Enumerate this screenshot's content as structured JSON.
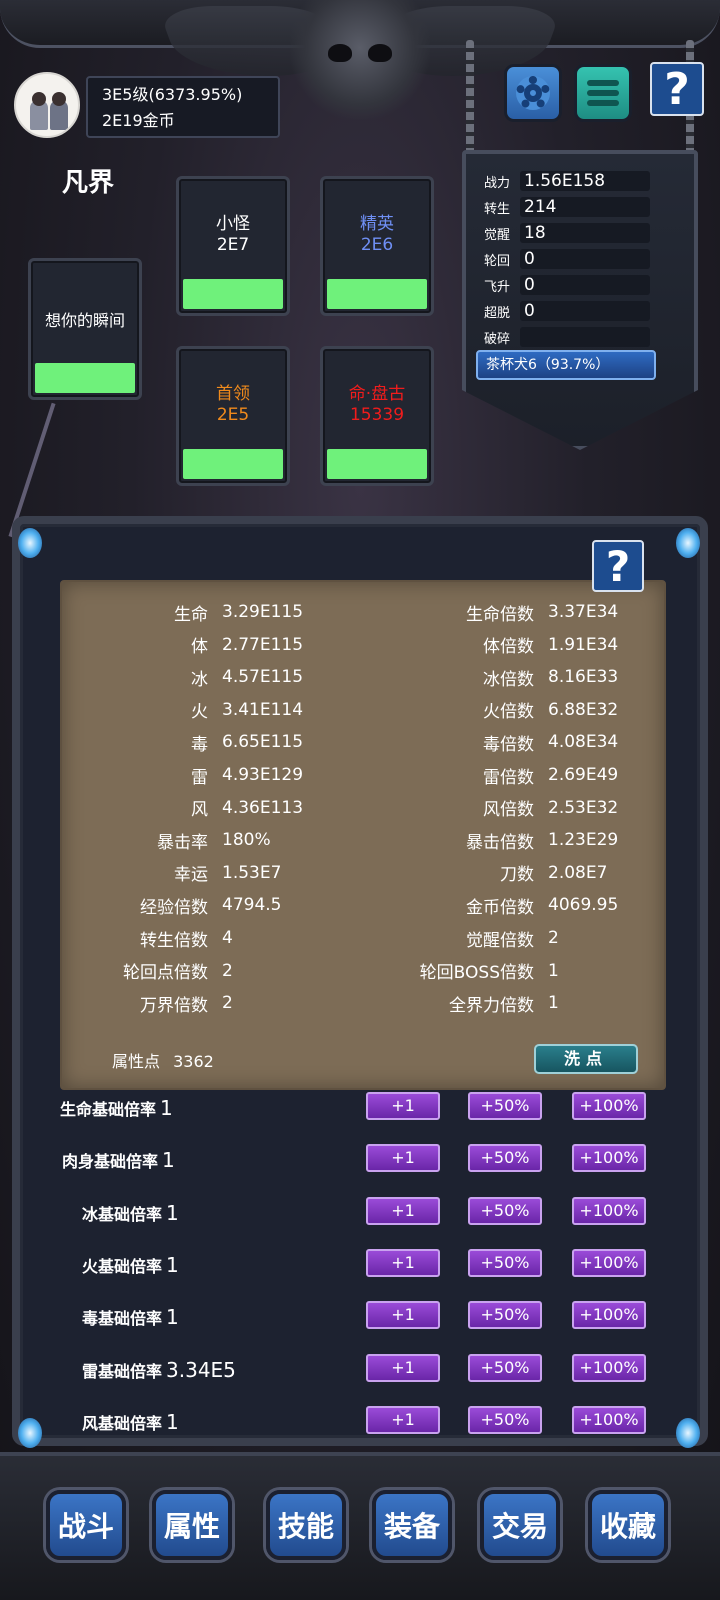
{
  "player": {
    "level_text": "3E5级(6373.95%)",
    "gold_text": "2E19金币"
  },
  "world": {
    "name": "凡界"
  },
  "cards": {
    "single": {
      "title": "想你的瞬间",
      "progress": 1.0
    },
    "minion": {
      "title": "小怪",
      "count": "2E7",
      "color": "#ffffff",
      "progress": 1.0
    },
    "elite": {
      "title": "精英",
      "count": "2E6",
      "color": "#6f8ff4",
      "progress": 1.0
    },
    "boss": {
      "title": "首领",
      "count": "2E5",
      "color": "#f08a1c",
      "progress": 1.0
    },
    "fate": {
      "title": "命·盘古",
      "count": "15339",
      "color": "#f01c1c",
      "progress": 1.0
    }
  },
  "stats": [
    {
      "label": "战力",
      "value": "1.56E158"
    },
    {
      "label": "转生",
      "value": "214"
    },
    {
      "label": "觉醒",
      "value": "18"
    },
    {
      "label": "轮回",
      "value": "0"
    },
    {
      "label": "飞升",
      "value": "0"
    },
    {
      "label": "超脱",
      "value": "0"
    },
    {
      "label": "破碎",
      "value": ""
    }
  ],
  "realm": {
    "text": "茶杯犬6（93.7%）"
  },
  "attributes_left": [
    {
      "key": "生命",
      "value": "3.29E115"
    },
    {
      "key": "体",
      "value": "2.77E115"
    },
    {
      "key": "冰",
      "value": "4.57E115"
    },
    {
      "key": "火",
      "value": "3.41E114"
    },
    {
      "key": "毒",
      "value": "6.65E115"
    },
    {
      "key": "雷",
      "value": "4.93E129"
    },
    {
      "key": "风",
      "value": "4.36E113"
    },
    {
      "key": "暴击率",
      "value": "180%"
    },
    {
      "key": "幸运",
      "value": "1.53E7"
    },
    {
      "key": "经验倍数",
      "value": "4794.5"
    },
    {
      "key": "转生倍数",
      "value": "4"
    },
    {
      "key": "轮回点倍数",
      "value": "2"
    },
    {
      "key": "万界倍数",
      "value": "2"
    }
  ],
  "attributes_right": [
    {
      "key": "生命倍数",
      "value": "3.37E34"
    },
    {
      "key": "体倍数",
      "value": "1.91E34"
    },
    {
      "key": "冰倍数",
      "value": "8.16E33"
    },
    {
      "key": "火倍数",
      "value": "6.88E32"
    },
    {
      "key": "毒倍数",
      "value": "4.08E34"
    },
    {
      "key": "雷倍数",
      "value": "2.69E49"
    },
    {
      "key": "风倍数",
      "value": "2.53E32"
    },
    {
      "key": "暴击倍数",
      "value": "1.23E29"
    },
    {
      "key": "刀数",
      "value": "2.08E7"
    },
    {
      "key": "金币倍数",
      "value": "4069.95"
    },
    {
      "key": "觉醒倍数",
      "value": "2"
    },
    {
      "key": "轮回BOSS倍数",
      "value": "1"
    },
    {
      "key": "全界力倍数",
      "value": "1"
    }
  ],
  "attribute_points": {
    "label": "属性点",
    "value": "3362"
  },
  "wash_button": "洗点",
  "base_rates": [
    {
      "name": "生命基础倍率",
      "value": "1"
    },
    {
      "name": "肉身基础倍率",
      "value": "1"
    },
    {
      "name": "冰基础倍率",
      "value": "1"
    },
    {
      "name": "火基础倍率",
      "value": "1"
    },
    {
      "name": "毒基础倍率",
      "value": "1"
    },
    {
      "name": "雷基础倍率",
      "value": "3.34E5"
    },
    {
      "name": "风基础倍率",
      "value": "1"
    }
  ],
  "rate_buttons": [
    "+1",
    "+50%",
    "+100%"
  ],
  "help_label": "?",
  "nav": [
    {
      "label": "战斗"
    },
    {
      "label": "属性"
    },
    {
      "label": "技能"
    },
    {
      "label": "装备"
    },
    {
      "label": "交易"
    },
    {
      "label": "收藏"
    }
  ],
  "icons": {
    "settings": "gear-icon",
    "menu": "menu-icon",
    "help": "question-icon"
  }
}
